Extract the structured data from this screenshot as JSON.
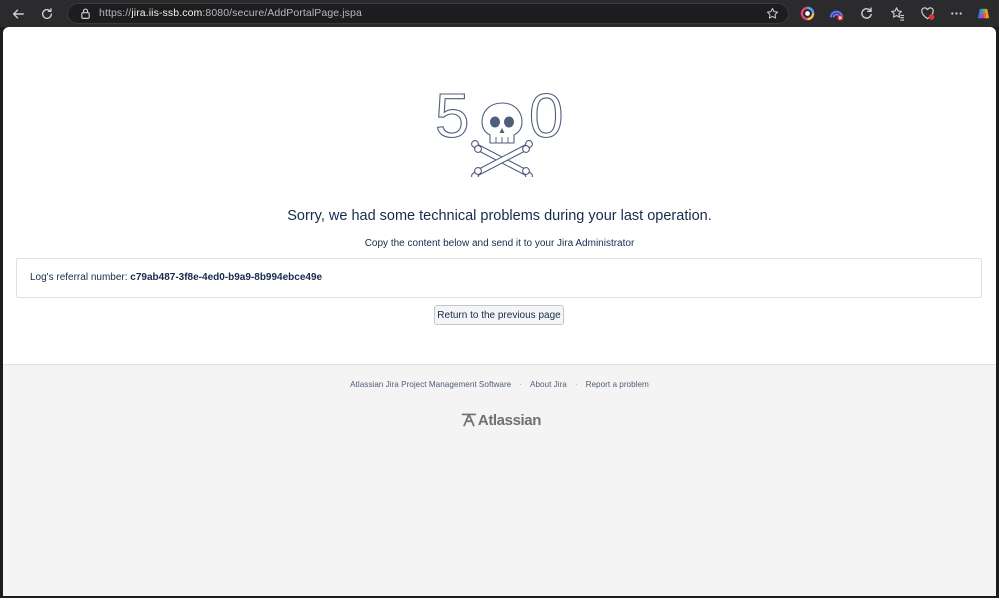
{
  "browser": {
    "url_scheme": "https://",
    "url_host": "jira.iis-ssb.com",
    "url_path": ":8080/secure/AddPortalPage.jspa"
  },
  "error": {
    "code_left": "5",
    "code_right": "0",
    "headline": "Sorry, we had some technical problems during your last operation.",
    "instruction": "Copy the content below and send it to your Jira Administrator",
    "log_label": "Log's referral number: ",
    "log_number": "c79ab487-3f8e-4ed0-b9a9-8b994ebce49e",
    "return_label": "Return to the previous page"
  },
  "footer": {
    "links": [
      "Atlassian Jira Project Management Software",
      "About Jira",
      "Report a problem"
    ],
    "separator": "·",
    "logo_text": "Atlassian"
  },
  "colors": {
    "chrome": "#2b2b2d",
    "text": "#172b4d",
    "footer_bg": "#f4f4f4"
  }
}
